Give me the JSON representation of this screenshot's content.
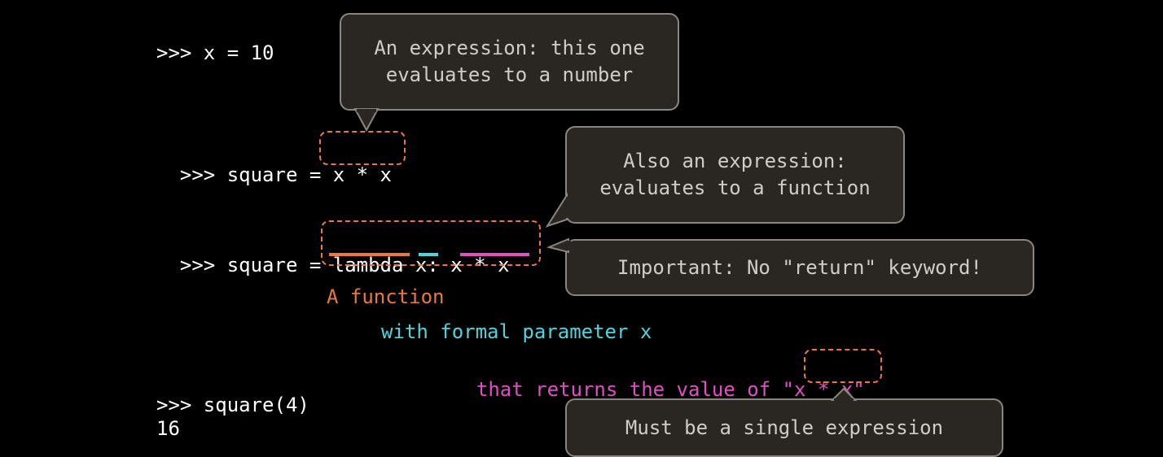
{
  "colors": {
    "background": "#000000",
    "code_text": "#ffffff",
    "callout_bg": "#2a2622",
    "callout_border": "#8a8580",
    "callout_text": "#d0ccc7",
    "function_orange": "#e67a3c",
    "parameter_cyan": "#4fd3dc",
    "body_magenta": "#e04fc4"
  },
  "code": {
    "line1": ">>> x = 10",
    "line2_prefix": ">>> square = ",
    "line2_expr": "x * x",
    "line3_prefix": ">>> square = ",
    "line3_lambda": "lambda",
    "line3_param": "x",
    "line3_colon": ":",
    "line3_body": "x * x",
    "line4": ">>> square(4)",
    "line5": "16"
  },
  "explanation": {
    "function": "A function",
    "parameter": "with formal parameter x",
    "returns_prefix": "that returns the value of \"",
    "returns_expr": "x * x",
    "returns_suffix": "\""
  },
  "callouts": {
    "expression_number": "An expression: this one\nevaluates to a number",
    "expression_function": "Also an expression:\nevaluates to a function",
    "no_return": "Important: No \"return\" keyword!",
    "single_expression": "Must be a single expression"
  }
}
